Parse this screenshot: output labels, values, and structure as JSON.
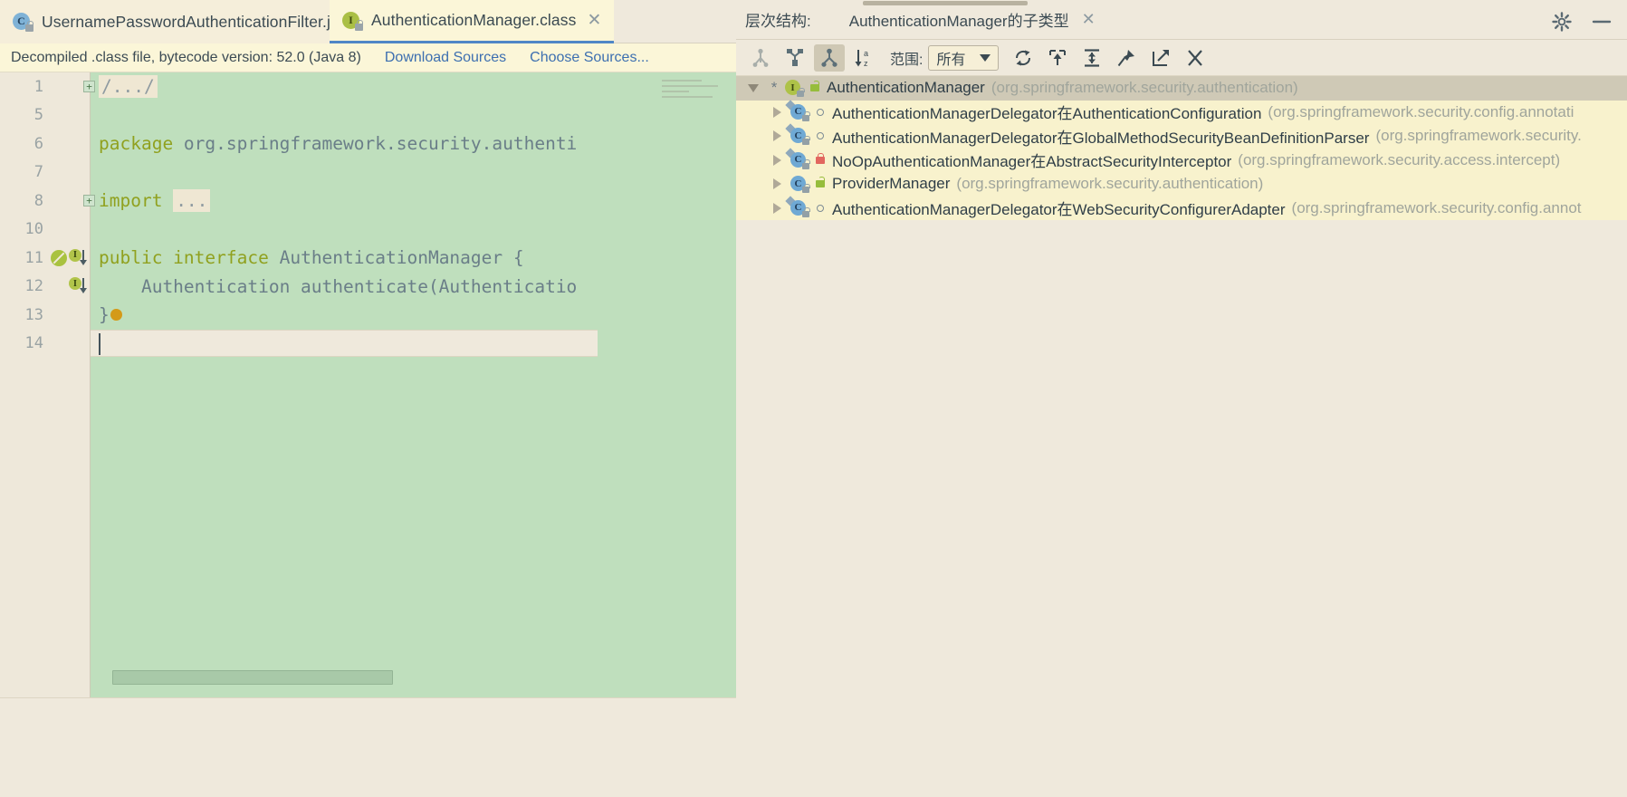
{
  "editor": {
    "tabs": [
      {
        "label": "UsernamePasswordAuthenticationFilter.java",
        "icon": "java-class-icon",
        "active": false,
        "close": "✕"
      },
      {
        "label": "AuthenticationManager.class",
        "icon": "java-interface-icon",
        "active": true,
        "close": "✕"
      }
    ],
    "notification": {
      "text": "Decompiled .class file, bytecode version: 52.0 (Java 8)",
      "download_sources": "Download Sources",
      "choose_sources": "Choose Sources..."
    },
    "line_numbers": [
      "1",
      "5",
      "6",
      "7",
      "8",
      "10",
      "11",
      "12",
      "13",
      "14"
    ],
    "code_lines": [
      {
        "n": "1",
        "fold": "+",
        "segments": [
          {
            "t": "/.../",
            "cls": "ph"
          }
        ]
      },
      {
        "n": "5",
        "fold": "",
        "segments": []
      },
      {
        "n": "6",
        "fold": "",
        "segments": [
          {
            "t": "package ",
            "cls": "kw"
          },
          {
            "t": "org.springframework.security.authenti",
            "cls": "plain"
          }
        ]
      },
      {
        "n": "7",
        "fold": "",
        "segments": []
      },
      {
        "n": "8",
        "fold": "+",
        "segments": [
          {
            "t": "import ",
            "cls": "kw"
          },
          {
            "t": "...",
            "cls": "ph"
          }
        ]
      },
      {
        "n": "10",
        "fold": "",
        "segments": []
      },
      {
        "n": "11",
        "fold": "",
        "segments": [
          {
            "t": "public interface ",
            "cls": "kw"
          },
          {
            "t": "AuthenticationManager {",
            "cls": "plain"
          }
        ]
      },
      {
        "n": "12",
        "fold": "",
        "segments": [
          {
            "t": "    Authentication authenticate(Authenticatio",
            "cls": "plain"
          }
        ]
      },
      {
        "n": "13",
        "fold": "",
        "segments": [
          {
            "t": "}",
            "cls": "brace"
          },
          {
            "t": "",
            "cls": "bulb"
          }
        ]
      },
      {
        "n": "14",
        "fold": "",
        "segments": []
      }
    ],
    "gutter_markers": {
      "11": [
        "no-override-icon",
        "implemented-by-icon"
      ],
      "12": [
        "implemented-by-icon"
      ]
    },
    "caret_line": "14"
  },
  "hierarchy": {
    "header_label": "层次结构:",
    "tab_title": "AuthenticationManager的子类型",
    "tab_close": "✕",
    "window_buttons": {
      "settings": "gear-icon",
      "minimize": "minimize-icon"
    },
    "toolbar": {
      "buttons": [
        {
          "name": "type-hierarchy-button",
          "icon": "type-hierarchy-icon",
          "selected": false
        },
        {
          "name": "supertypes-hierarchy-button",
          "icon": "supertypes-icon",
          "selected": false
        },
        {
          "name": "subtypes-hierarchy-button",
          "icon": "subtypes-icon",
          "selected": true
        },
        {
          "name": "sort-alphabetically-button",
          "icon": "sort-az-icon",
          "selected": false
        }
      ],
      "scope_label": "范围:",
      "scope_value": "所有",
      "right_buttons": [
        {
          "name": "refresh-button",
          "icon": "refresh-icon"
        },
        {
          "name": "expand-all-button",
          "icon": "expand-all-icon"
        },
        {
          "name": "collapse-all-button",
          "icon": "collapse-all-icon"
        },
        {
          "name": "pin-tab-button",
          "icon": "pin-icon"
        },
        {
          "name": "open-in-editor-button",
          "icon": "export-icon"
        },
        {
          "name": "close-button",
          "icon": "close-icon"
        }
      ]
    },
    "tree": [
      {
        "level": 0,
        "expanded": true,
        "star": "*",
        "icon": "java-interface-icon",
        "visibility": "public",
        "name": "AuthenticationManager",
        "package": "(org.springframework.security.authentication)",
        "selected": true
      },
      {
        "level": 1,
        "expanded": false,
        "star": "",
        "icon": "java-class-icon",
        "visibility": "package",
        "name": "AuthenticationManagerDelegator在AuthenticationConfiguration",
        "package": "(org.springframework.security.config.annotati",
        "selected": false
      },
      {
        "level": 1,
        "expanded": false,
        "star": "",
        "icon": "java-class-icon",
        "visibility": "package",
        "name": "AuthenticationManagerDelegator在GlobalMethodSecurityBeanDefinitionParser",
        "package": "(org.springframework.security.",
        "selected": false
      },
      {
        "level": 1,
        "expanded": false,
        "star": "",
        "icon": "java-class-icon",
        "visibility": "private",
        "name": "NoOpAuthenticationManager在AbstractSecurityInterceptor",
        "package": "(org.springframework.security.access.intercept)",
        "selected": false
      },
      {
        "level": 1,
        "expanded": false,
        "star": "",
        "icon": "java-class-icon",
        "visibility": "public",
        "name": "ProviderManager",
        "package": "(org.springframework.security.authentication)",
        "selected": false
      },
      {
        "level": 1,
        "expanded": false,
        "star": "",
        "icon": "java-class-icon",
        "visibility": "package",
        "name": "AuthenticationManagerDelegator在WebSecurityConfigurerAdapter",
        "package": "(org.springframework.security.config.annot",
        "selected": false
      }
    ]
  },
  "colors": {
    "editor_bg": "#bfdfbd",
    "gutter_bg": "#eee8da",
    "chrome_bg": "#efe9dc",
    "tab_active": "#fbf6d8",
    "tab_accent": "#4f86c6",
    "tree_row": "#f8f2cd",
    "tree_selected": "#cfc9b6",
    "keyword": "#90a11f",
    "link": "#3d6fb0"
  }
}
